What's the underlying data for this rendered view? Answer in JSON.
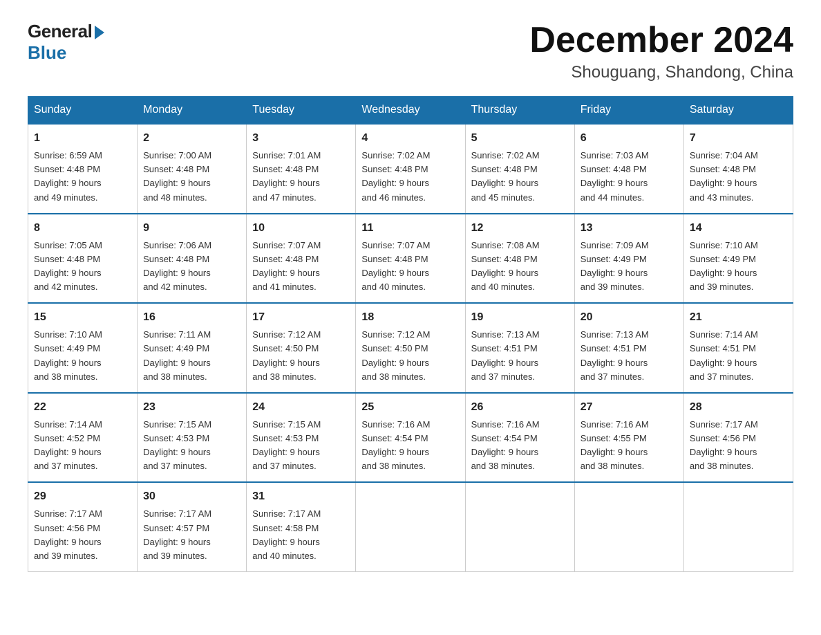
{
  "header": {
    "logo_general": "General",
    "logo_blue": "Blue",
    "month_title": "December 2024",
    "location": "Shouguang, Shandong, China"
  },
  "weekdays": [
    "Sunday",
    "Monday",
    "Tuesday",
    "Wednesday",
    "Thursday",
    "Friday",
    "Saturday"
  ],
  "weeks": [
    [
      {
        "day": "1",
        "sunrise": "6:59 AM",
        "sunset": "4:48 PM",
        "daylight": "9 hours and 49 minutes."
      },
      {
        "day": "2",
        "sunrise": "7:00 AM",
        "sunset": "4:48 PM",
        "daylight": "9 hours and 48 minutes."
      },
      {
        "day": "3",
        "sunrise": "7:01 AM",
        "sunset": "4:48 PM",
        "daylight": "9 hours and 47 minutes."
      },
      {
        "day": "4",
        "sunrise": "7:02 AM",
        "sunset": "4:48 PM",
        "daylight": "9 hours and 46 minutes."
      },
      {
        "day": "5",
        "sunrise": "7:02 AM",
        "sunset": "4:48 PM",
        "daylight": "9 hours and 45 minutes."
      },
      {
        "day": "6",
        "sunrise": "7:03 AM",
        "sunset": "4:48 PM",
        "daylight": "9 hours and 44 minutes."
      },
      {
        "day": "7",
        "sunrise": "7:04 AM",
        "sunset": "4:48 PM",
        "daylight": "9 hours and 43 minutes."
      }
    ],
    [
      {
        "day": "8",
        "sunrise": "7:05 AM",
        "sunset": "4:48 PM",
        "daylight": "9 hours and 42 minutes."
      },
      {
        "day": "9",
        "sunrise": "7:06 AM",
        "sunset": "4:48 PM",
        "daylight": "9 hours and 42 minutes."
      },
      {
        "day": "10",
        "sunrise": "7:07 AM",
        "sunset": "4:48 PM",
        "daylight": "9 hours and 41 minutes."
      },
      {
        "day": "11",
        "sunrise": "7:07 AM",
        "sunset": "4:48 PM",
        "daylight": "9 hours and 40 minutes."
      },
      {
        "day": "12",
        "sunrise": "7:08 AM",
        "sunset": "4:48 PM",
        "daylight": "9 hours and 40 minutes."
      },
      {
        "day": "13",
        "sunrise": "7:09 AM",
        "sunset": "4:49 PM",
        "daylight": "9 hours and 39 minutes."
      },
      {
        "day": "14",
        "sunrise": "7:10 AM",
        "sunset": "4:49 PM",
        "daylight": "9 hours and 39 minutes."
      }
    ],
    [
      {
        "day": "15",
        "sunrise": "7:10 AM",
        "sunset": "4:49 PM",
        "daylight": "9 hours and 38 minutes."
      },
      {
        "day": "16",
        "sunrise": "7:11 AM",
        "sunset": "4:49 PM",
        "daylight": "9 hours and 38 minutes."
      },
      {
        "day": "17",
        "sunrise": "7:12 AM",
        "sunset": "4:50 PM",
        "daylight": "9 hours and 38 minutes."
      },
      {
        "day": "18",
        "sunrise": "7:12 AM",
        "sunset": "4:50 PM",
        "daylight": "9 hours and 38 minutes."
      },
      {
        "day": "19",
        "sunrise": "7:13 AM",
        "sunset": "4:51 PM",
        "daylight": "9 hours and 37 minutes."
      },
      {
        "day": "20",
        "sunrise": "7:13 AM",
        "sunset": "4:51 PM",
        "daylight": "9 hours and 37 minutes."
      },
      {
        "day": "21",
        "sunrise": "7:14 AM",
        "sunset": "4:51 PM",
        "daylight": "9 hours and 37 minutes."
      }
    ],
    [
      {
        "day": "22",
        "sunrise": "7:14 AM",
        "sunset": "4:52 PM",
        "daylight": "9 hours and 37 minutes."
      },
      {
        "day": "23",
        "sunrise": "7:15 AM",
        "sunset": "4:53 PM",
        "daylight": "9 hours and 37 minutes."
      },
      {
        "day": "24",
        "sunrise": "7:15 AM",
        "sunset": "4:53 PM",
        "daylight": "9 hours and 37 minutes."
      },
      {
        "day": "25",
        "sunrise": "7:16 AM",
        "sunset": "4:54 PM",
        "daylight": "9 hours and 38 minutes."
      },
      {
        "day": "26",
        "sunrise": "7:16 AM",
        "sunset": "4:54 PM",
        "daylight": "9 hours and 38 minutes."
      },
      {
        "day": "27",
        "sunrise": "7:16 AM",
        "sunset": "4:55 PM",
        "daylight": "9 hours and 38 minutes."
      },
      {
        "day": "28",
        "sunrise": "7:17 AM",
        "sunset": "4:56 PM",
        "daylight": "9 hours and 38 minutes."
      }
    ],
    [
      {
        "day": "29",
        "sunrise": "7:17 AM",
        "sunset": "4:56 PM",
        "daylight": "9 hours and 39 minutes."
      },
      {
        "day": "30",
        "sunrise": "7:17 AM",
        "sunset": "4:57 PM",
        "daylight": "9 hours and 39 minutes."
      },
      {
        "day": "31",
        "sunrise": "7:17 AM",
        "sunset": "4:58 PM",
        "daylight": "9 hours and 40 minutes."
      },
      null,
      null,
      null,
      null
    ]
  ],
  "labels": {
    "sunrise": "Sunrise:",
    "sunset": "Sunset:",
    "daylight": "Daylight:"
  }
}
